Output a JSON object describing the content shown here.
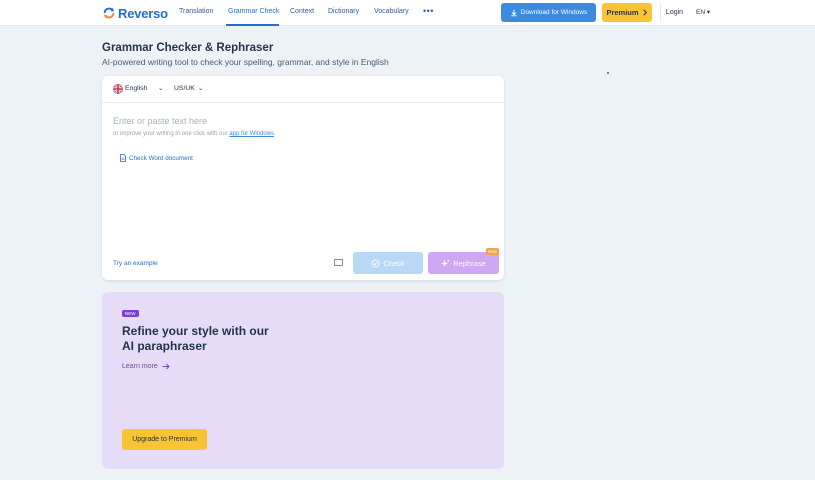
{
  "brand": {
    "name": "Reverso"
  },
  "nav": {
    "items": [
      "Translation",
      "Grammar Check",
      "Context",
      "Dictionary",
      "Vocabulary"
    ],
    "active": "Grammar Check",
    "more": "•••"
  },
  "header": {
    "download_label": "Download for Windows",
    "premium_label": "Premium",
    "login_label": "Login",
    "language": "EN"
  },
  "page": {
    "title": "Grammar Checker & Rephraser",
    "subtitle": "AI-powered writing tool to check your spelling, grammar, and style in English"
  },
  "editor": {
    "language": "English",
    "variant": "US/UK",
    "placeholder": "Enter or paste text here",
    "improve_text": "or improve your writing in one click with our",
    "improve_link": "app for Windows",
    "check_word_label": "Check Word document",
    "try_example_label": "Try an example",
    "check_label": "Check",
    "rephrase_label": "Rephrase",
    "new_tag": "New"
  },
  "promo": {
    "badge": "NEW",
    "title_line1": "Refine your style with our",
    "title_line2": "AI paraphraser",
    "learn_more_label": "Learn more",
    "upgrade_label": "Upgrade to Premium"
  },
  "colors": {
    "accent": "#1f6fd1",
    "download_bg": "#3d8bde",
    "premium_bg": "#f9c433",
    "check_bg": "#b9d8f6",
    "rephrase_bg": "#cfa7f2",
    "promo_bg": "#e6dcf8",
    "page_bg": "#edf2f7"
  }
}
